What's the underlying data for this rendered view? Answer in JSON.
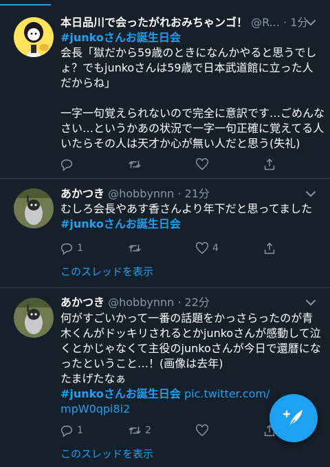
{
  "tweets": [
    {
      "name": "本日品川で会ったがれおみちゃンゴ！",
      "handle": "@R...",
      "dot": "·",
      "time": "1分",
      "hashtag": "#junkoさんお誕生日会",
      "lines": [
        "会長「獄だから59歳のときになんかやると思うでし",
        "ょ？でもjunkoさんは59歳で日本武道館に立った人",
        "だからね」",
        "",
        "一字一句覚えられないので完全に意訳です…ごめんな",
        "さい…というかあの状況で一字一句正確に覚えてる人",
        "いたらその人は天才か心が無い人だと思う(失礼)"
      ],
      "reply_count": "",
      "retweet_count": "",
      "like_count": ""
    },
    {
      "name": "あかつき",
      "handle": "@hobbynnn",
      "dot": "·",
      "time": "21分",
      "line1": "むしろ会長やあす香さんより年下だと思ってました",
      "hashtag": "#junkoさんお誕生日会",
      "reply_count": "1",
      "retweet_count": "",
      "like_count": "4",
      "show_thread": "このスレッドを表示"
    },
    {
      "name": "あかつき",
      "handle": "@hobbynnn",
      "dot": "·",
      "time": "22分",
      "lines": [
        "何がすごいかって一番の話題をかっさらったのが青",
        "木くんがドッキリされるとかjunkoさんが感動して泣",
        "くとかじゃなくて主役のjunkoさんが今日で還暦にな",
        "ったということ…！(画像は去年)",
        "たまげたなぁ"
      ],
      "hashtag": "#junkoさんお誕生日会",
      "link_part1": "pic.twitter.com/",
      "link_part2": "mpW0qpi8i2",
      "reply_count": "1",
      "retweet_count": "2",
      "like_count": "",
      "show_thread": "このスレッドを表示"
    }
  ],
  "colors": {
    "background": "#15202b",
    "accent": "#1da1f2",
    "muted": "#8899a6",
    "divider": "#38444d"
  },
  "icons": [
    "reply-icon",
    "retweet-icon",
    "like-icon",
    "share-icon",
    "chevron-down-icon",
    "compose-icon"
  ]
}
